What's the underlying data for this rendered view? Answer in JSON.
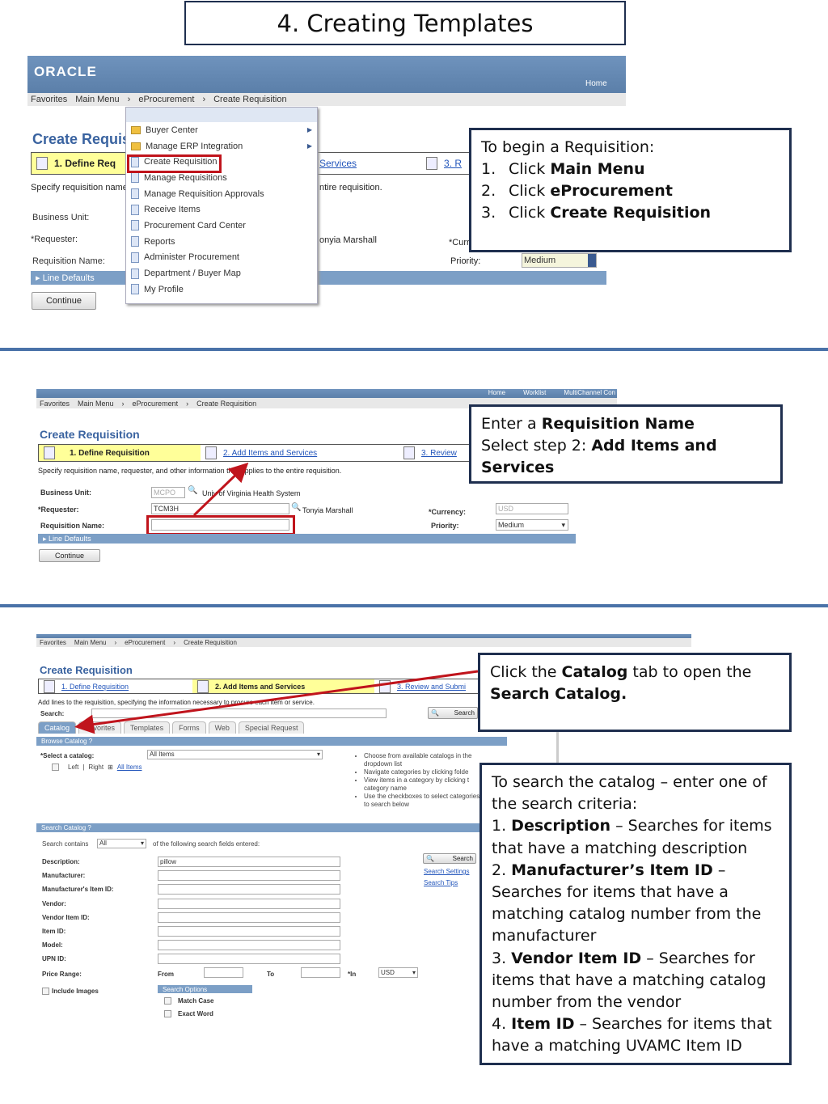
{
  "title": "4. Creating Templates",
  "s1": {
    "logo": "ORACLE",
    "home": "Home",
    "crumbs": [
      "Favorites",
      "Main Menu",
      "eProcurement",
      "Create Requisition"
    ],
    "page_title": "Create Requisi",
    "step1": "1. Define Req",
    "step2": "Services",
    "step3": "3. R",
    "instr": "Specify requisition name,",
    "instr_tail": "ntire requisition.",
    "bu": "Business Unit:",
    "req": "*Requester:",
    "reqname": "Requisition Name:",
    "requester_name": "onyia Marshall",
    "cur": "*Curr",
    "priority": "Priority:",
    "priority_val": "Medium",
    "line_defaults": "Line Defaults",
    "continue": "Continue",
    "menu": [
      {
        "label": "Buyer Center",
        "icon": "folder",
        "sub": true
      },
      {
        "label": "Manage ERP Integration",
        "icon": "folder",
        "sub": true
      },
      {
        "label": "Create Requisition",
        "icon": "doc",
        "sub": false
      },
      {
        "label": "Manage Requisitions",
        "icon": "doc"
      },
      {
        "label": "Manage Requisition Approvals",
        "icon": "doc"
      },
      {
        "label": "Receive Items",
        "icon": "doc"
      },
      {
        "label": "Procurement Card Center",
        "icon": "doc"
      },
      {
        "label": "Reports",
        "icon": "doc"
      },
      {
        "label": "Administer Procurement",
        "icon": "doc"
      },
      {
        "label": "Department / Buyer Map",
        "icon": "doc"
      },
      {
        "label": "My Profile",
        "icon": "doc"
      }
    ],
    "callout": {
      "intro": "To begin a Requisition:",
      "items": [
        {
          "n": "1.",
          "pre": "Click ",
          "bold": "Main Menu"
        },
        {
          "n": "2.",
          "pre": "Click ",
          "bold": "eProcurement"
        },
        {
          "n": "3.",
          "pre": "Click ",
          "bold": "Create Requisition"
        }
      ]
    }
  },
  "s2": {
    "topnav": [
      "Home",
      "Worklist",
      "MultiChannel Con"
    ],
    "crumbs": [
      "Favorites",
      "Main Menu",
      "eProcurement",
      "Create Requisition"
    ],
    "page_title": "Create Requisition",
    "step1": "1. Define Requisition",
    "step2": "2. Add Items and Services",
    "step3": "3. Review",
    "instr": "Specify requisition name, requester, and other information that applies to the entire requisition.",
    "bu": "Business Unit:",
    "bu_val": "MCPO",
    "bu_desc": "Univ of Virginia Health System",
    "req": "*Requester:",
    "req_val": "TCM3H",
    "req_desc": "Tonyia Marshall",
    "reqname": "Requisition Name:",
    "cur": "*Currency:",
    "cur_val": "USD",
    "priority": "Priority:",
    "priority_val": "Medium",
    "line_defaults": "Line Defaults",
    "continue": "Continue",
    "callout": {
      "l1_pre": "Enter a ",
      "l1_bold": "Requisition Name",
      "l2_pre": "Select step 2: ",
      "l2_bold": "Add Items and Services"
    }
  },
  "s3": {
    "crumbs": [
      "Favorites",
      "Main Menu",
      "eProcurement",
      "Create Requisition"
    ],
    "page_title": "Create Requisition",
    "step1": "1. Define Requisition",
    "step2": "2. Add Items and Services",
    "step3": "3. Review and Submi",
    "instr": "Add lines to the requisition, specifying the information necessary to procure each item or service.",
    "search": "Search:",
    "search_btn": "Search",
    "tabs": [
      "Catalog",
      "Favorites",
      "Templates",
      "Forms",
      "Web",
      "Special Request"
    ],
    "browse": "Browse Catalog",
    "select_catalog": "*Select a catalog:",
    "catalog_val": "All Items",
    "left": "Left",
    "right": "Right",
    "all_items": "All Items",
    "tips": [
      "Choose from available catalogs in the dropdown list",
      "Navigate categories by clicking folde",
      "View items in a category by clicking t category name",
      "Use the checkboxes to select categories to search below"
    ],
    "search_catalog": "Search Catalog",
    "contains": "Search contains",
    "contains_val": "All",
    "contains_tail": "of the following search fields entered:",
    "fields": [
      {
        "label": "Description:",
        "value": "pillow"
      },
      {
        "label": "Manufacturer:",
        "value": ""
      },
      {
        "label": "Manufacturer's Item ID:",
        "value": ""
      },
      {
        "label": "Vendor:",
        "value": ""
      },
      {
        "label": "Vendor Item ID:",
        "value": ""
      },
      {
        "label": "Item ID:",
        "value": ""
      },
      {
        "label": "Model:",
        "value": ""
      },
      {
        "label": "UPN ID:",
        "value": ""
      }
    ],
    "price": "Price Range:",
    "from": "From",
    "to": "To",
    "in": "*In",
    "currency": "USD",
    "search_settings": "Search Settings",
    "search_tips": "Search Tips",
    "include_images": "Include Images",
    "search_options": "Search Options",
    "match_case": "Match Case",
    "exact_word": "Exact Word",
    "callout1": {
      "pre": "Click the ",
      "b1": "Catalog",
      "mid": " tab to open the ",
      "b2": "Search Catalog."
    },
    "callout2": {
      "intro": "To search the catalog – enter one of the search criteria:",
      "items": [
        {
          "n": "1. ",
          "bold": "Description",
          "rest": " – Searches for items that have a matching description"
        },
        {
          "n": "2. ",
          "bold": "Manufacturer’s Item ID",
          "rest": " – Searches for items that have a matching catalog number from the manufacturer"
        },
        {
          "n": "3. ",
          "bold": "Vendor Item ID",
          "rest": " – Searches for items that have a matching catalog number from the vendor"
        },
        {
          "n": "4. ",
          "bold": "Item ID",
          "rest": " – Searches for items that have a matching UVAMC Item ID"
        }
      ]
    }
  },
  "colors": {
    "highlight_red": "#c0141c",
    "header_blue": "#6f93bd",
    "step_yellow": "#ffff99",
    "callout_border": "#1f2f4f"
  }
}
